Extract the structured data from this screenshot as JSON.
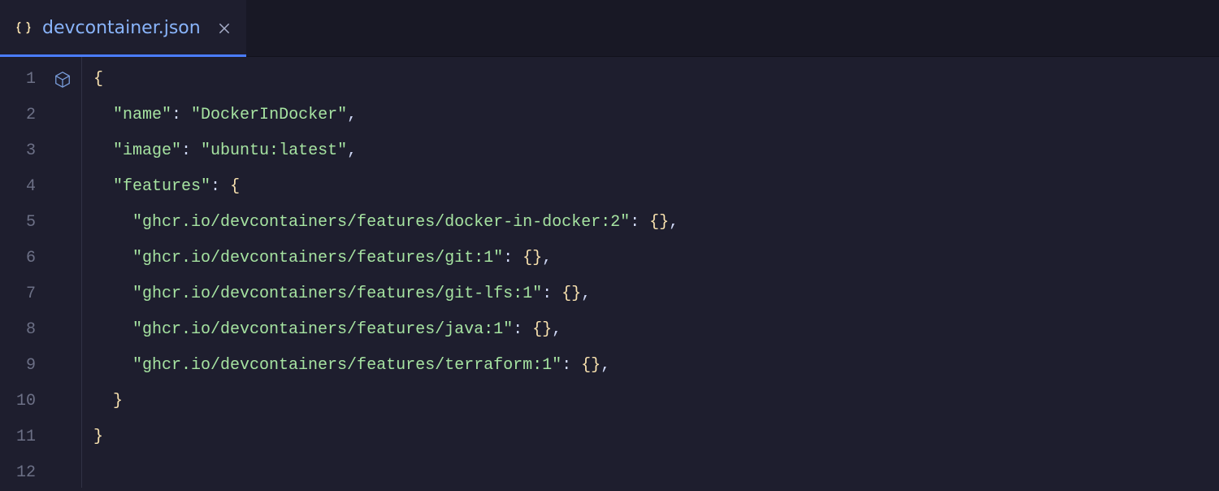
{
  "tab": {
    "title": "devcontainer.json",
    "active": true
  },
  "code": {
    "lines": [
      {
        "n": 1,
        "indent": 0,
        "tokens": [
          [
            "brace",
            "{"
          ]
        ]
      },
      {
        "n": 2,
        "indent": 1,
        "tokens": [
          [
            "key",
            "\"name\""
          ],
          [
            "colon",
            ": "
          ],
          [
            "str",
            "\"DockerInDocker\""
          ],
          [
            "comma",
            ","
          ]
        ]
      },
      {
        "n": 3,
        "indent": 1,
        "tokens": [
          [
            "key",
            "\"image\""
          ],
          [
            "colon",
            ": "
          ],
          [
            "str",
            "\"ubuntu:latest\""
          ],
          [
            "comma",
            ","
          ]
        ]
      },
      {
        "n": 4,
        "indent": 1,
        "tokens": [
          [
            "key",
            "\"features\""
          ],
          [
            "colon",
            ": "
          ],
          [
            "brace",
            "{"
          ]
        ]
      },
      {
        "n": 5,
        "indent": 2,
        "tokens": [
          [
            "key",
            "\"ghcr.io/devcontainers/features/docker-in-docker:2\""
          ],
          [
            "colon",
            ": "
          ],
          [
            "brace",
            "{}"
          ],
          [
            "comma",
            ","
          ]
        ]
      },
      {
        "n": 6,
        "indent": 2,
        "tokens": [
          [
            "key",
            "\"ghcr.io/devcontainers/features/git:1\""
          ],
          [
            "colon",
            ": "
          ],
          [
            "brace",
            "{}"
          ],
          [
            "comma",
            ","
          ]
        ]
      },
      {
        "n": 7,
        "indent": 2,
        "tokens": [
          [
            "key",
            "\"ghcr.io/devcontainers/features/git-lfs:1\""
          ],
          [
            "colon",
            ": "
          ],
          [
            "brace",
            "{}"
          ],
          [
            "comma",
            ","
          ]
        ]
      },
      {
        "n": 8,
        "indent": 2,
        "tokens": [
          [
            "key",
            "\"ghcr.io/devcontainers/features/java:1\""
          ],
          [
            "colon",
            ": "
          ],
          [
            "brace",
            "{}"
          ],
          [
            "comma",
            ","
          ]
        ]
      },
      {
        "n": 9,
        "indent": 2,
        "tokens": [
          [
            "key",
            "\"ghcr.io/devcontainers/features/terraform:1\""
          ],
          [
            "colon",
            ": "
          ],
          [
            "brace",
            "{}"
          ],
          [
            "comma",
            ","
          ]
        ]
      },
      {
        "n": 10,
        "indent": 1,
        "tokens": [
          [
            "brace",
            "}"
          ]
        ]
      },
      {
        "n": 11,
        "indent": 0,
        "tokens": [
          [
            "brace",
            "}"
          ]
        ]
      },
      {
        "n": 12,
        "indent": 0,
        "tokens": []
      }
    ],
    "indent_unit": "  "
  }
}
